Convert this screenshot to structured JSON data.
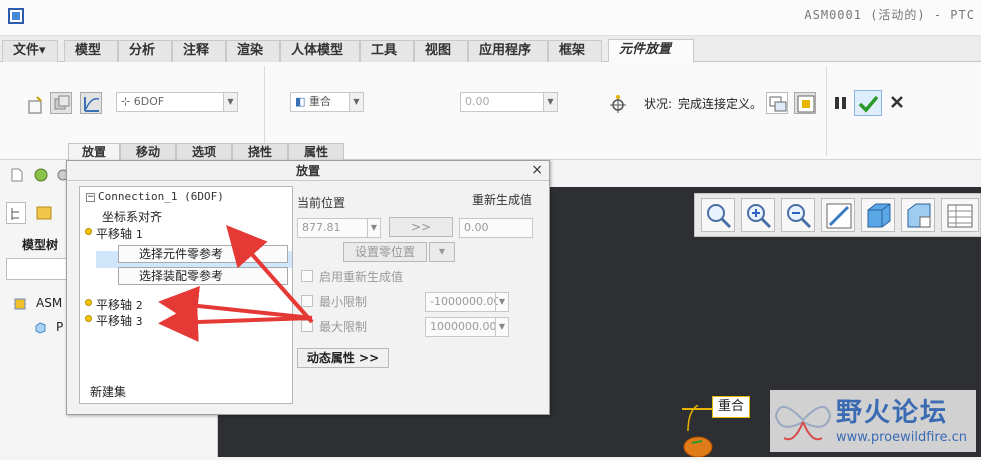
{
  "window": {
    "title": "ASM0001 (活动的) - PTC"
  },
  "ribbon_tabs": [
    {
      "label": "文件▾"
    },
    {
      "label": "模型"
    },
    {
      "label": "分析"
    },
    {
      "label": "注释"
    },
    {
      "label": "渲染"
    },
    {
      "label": "人体模型"
    },
    {
      "label": "工具"
    },
    {
      "label": "视图"
    },
    {
      "label": "应用程序"
    },
    {
      "label": "框架"
    },
    {
      "label": "元件放置"
    }
  ],
  "ribbon": {
    "connection_type": "6DOF",
    "constraint_type": "重合",
    "offset_value": "0.00",
    "status_label": "状况:",
    "status_text": "完成连接定义。"
  },
  "placement_tabs": [
    {
      "label": "放置"
    },
    {
      "label": "移动"
    },
    {
      "label": "选项"
    },
    {
      "label": "挠性"
    },
    {
      "label": "属性"
    }
  ],
  "left_panel": {
    "model_tree_label": "模型树",
    "tree_items": [
      "ASM",
      "P"
    ]
  },
  "dialog": {
    "title": "放置",
    "close": "×",
    "connection_node": "Connection_1 (6DOF)",
    "csys_align": "坐标系对齐",
    "constraints": [
      {
        "label": "平移轴",
        "index": "1"
      },
      {
        "label": "平移轴",
        "index": "2"
      },
      {
        "label": "平移轴",
        "index": "3"
      }
    ],
    "select_component_ref": "选择元件零参考",
    "select_assembly_ref": "选择装配零参考",
    "new_set": "新建集",
    "current_position_label": "当前位置",
    "regen_value_label": "重新生成值",
    "current_position_value": "877.81",
    "copy_button": ">>",
    "regen_value": "0.00",
    "set_zero_button": "设置零位置",
    "enable_regen_label": "启用重新生成值",
    "min_limit_label": "最小限制",
    "min_limit_value": "-1000000.00",
    "max_limit_label": "最大限制",
    "max_limit_value": "1000000.00",
    "dynamic_props_button": "动态属性 >>"
  },
  "graphics": {
    "constraint_tag": "重合"
  },
  "watermark": {
    "title": "野火论坛",
    "url": "www.proewildfire.cn"
  },
  "colors": {
    "accent": "#1f78d1",
    "arrow_red": "#e53935",
    "graphics_bg": "#2d2f33",
    "bullet": "#f3c700"
  }
}
